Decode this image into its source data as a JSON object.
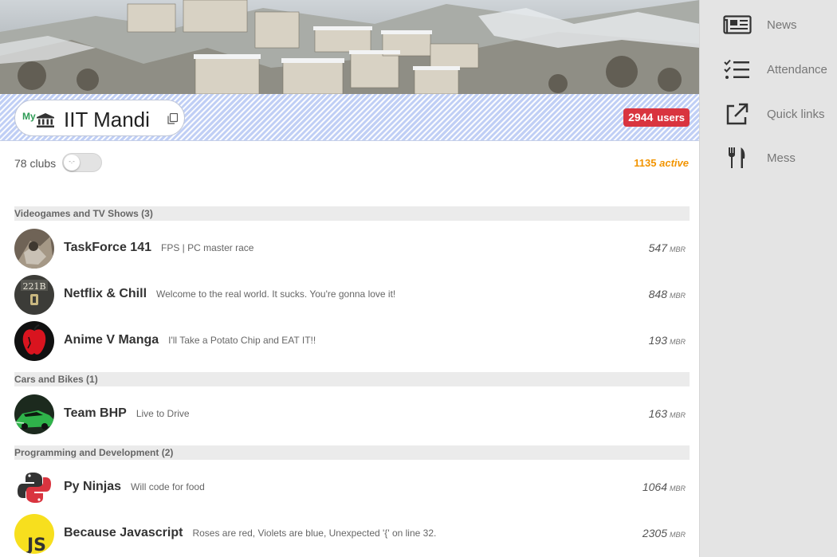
{
  "institute": {
    "my_label": "My",
    "name": "IIT Mandi",
    "users_count": "2944",
    "users_label": "users"
  },
  "clubs_summary": {
    "count_label": "78 clubs",
    "active_count": "1135",
    "active_label": "active"
  },
  "categories": [
    {
      "header": "Videogames and TV Shows (3)",
      "clubs": [
        {
          "name": "TaskForce 141",
          "desc": "FPS | PC master race",
          "members": "547",
          "mbr": "MBR"
        },
        {
          "name": "Netflix & Chill",
          "desc": "Welcome to the real world. It sucks. You're gonna love it!",
          "members": "848",
          "mbr": "MBR"
        },
        {
          "name": "Anime V Manga",
          "desc": "I'll Take a Potato Chip and EAT IT!!",
          "members": "193",
          "mbr": "MBR"
        }
      ]
    },
    {
      "header": "Cars and Bikes (1)",
      "clubs": [
        {
          "name": "Team BHP",
          "desc": "Live to Drive",
          "members": "163",
          "mbr": "MBR"
        }
      ]
    },
    {
      "header": "Programming and Development (2)",
      "clubs": [
        {
          "name": "Py Ninjas",
          "desc": "Will code for food",
          "members": "1064",
          "mbr": "MBR"
        },
        {
          "name": "Because Javascript",
          "desc": "Roses are red, Violets are blue, Unexpected '{' on line 32.",
          "members": "2305",
          "mbr": "MBR"
        }
      ]
    }
  ],
  "sidebar": {
    "items": [
      {
        "label": "News",
        "icon": "newspaper-icon"
      },
      {
        "label": "Attendance",
        "icon": "checklist-icon"
      },
      {
        "label": "Quick links",
        "icon": "external-link-icon"
      },
      {
        "label": "Mess",
        "icon": "fork-knife-icon"
      }
    ]
  },
  "avatar_text": {
    "netflix": "221B",
    "js": "JS"
  },
  "colors": {
    "users_badge": "#d9343f",
    "active": "#f29400",
    "my_label": "#2e9b55"
  }
}
